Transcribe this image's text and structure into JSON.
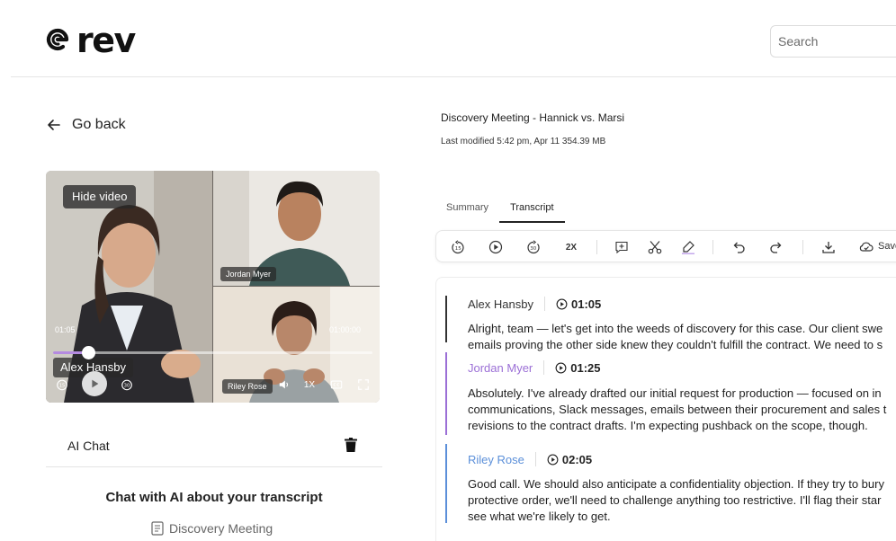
{
  "app": {
    "brand": "rev"
  },
  "header": {
    "search_placeholder": "Search"
  },
  "nav": {
    "go_back_label": "Go back"
  },
  "video": {
    "hide_video_label": "Hide video",
    "participants": {
      "main": "Alex Hansby",
      "top_right": "Jordan Myer",
      "bottom_right": "Riley Rose"
    },
    "current_time": "01:05",
    "total_time": "01:00:00",
    "progress_fraction": 0.11,
    "speed_label": "1X"
  },
  "ai_chat": {
    "label": "AI Chat",
    "heading": "Chat with AI about your transcript",
    "document_label": "Discovery Meeting"
  },
  "document": {
    "title": "Discovery Meeting - Hannick vs. Marsi",
    "meta": "Last modified 5:42 pm, Apr 11 354.39 MB"
  },
  "tabs": [
    {
      "label": "Summary",
      "active": false
    },
    {
      "label": "Transcript",
      "active": true
    }
  ],
  "toolbar": {
    "rewind_label": "15",
    "forward_label": "30",
    "speed_label": "2X",
    "save_label": "Save"
  },
  "transcript": [
    {
      "speaker": "Alex Hansby",
      "color": "#333333",
      "time": "01:05",
      "lines": [
        "Alright, team — let's get into the weeds of discovery for this case. Our client swe",
        "emails proving the other side knew they couldn't fulfill the contract. We need to s"
      ]
    },
    {
      "speaker": "Jordan Myer",
      "color": "#9b6fd6",
      "time": "01:25",
      "lines": [
        "Absolutely. I've already drafted our initial request for production — focused on in",
        "communications, Slack messages, emails between their procurement and sales t",
        "revisions to the contract drafts. I'm expecting pushback on the scope, though."
      ]
    },
    {
      "speaker": "Riley Rose",
      "color": "#5b8fd9",
      "time": "02:05",
      "lines": [
        "Good call. We should also anticipate a confidentiality objection. If they try to bury",
        "protective order, we'll need to challenge anything too restrictive. I'll flag their star",
        "see what we're likely to get."
      ]
    }
  ]
}
